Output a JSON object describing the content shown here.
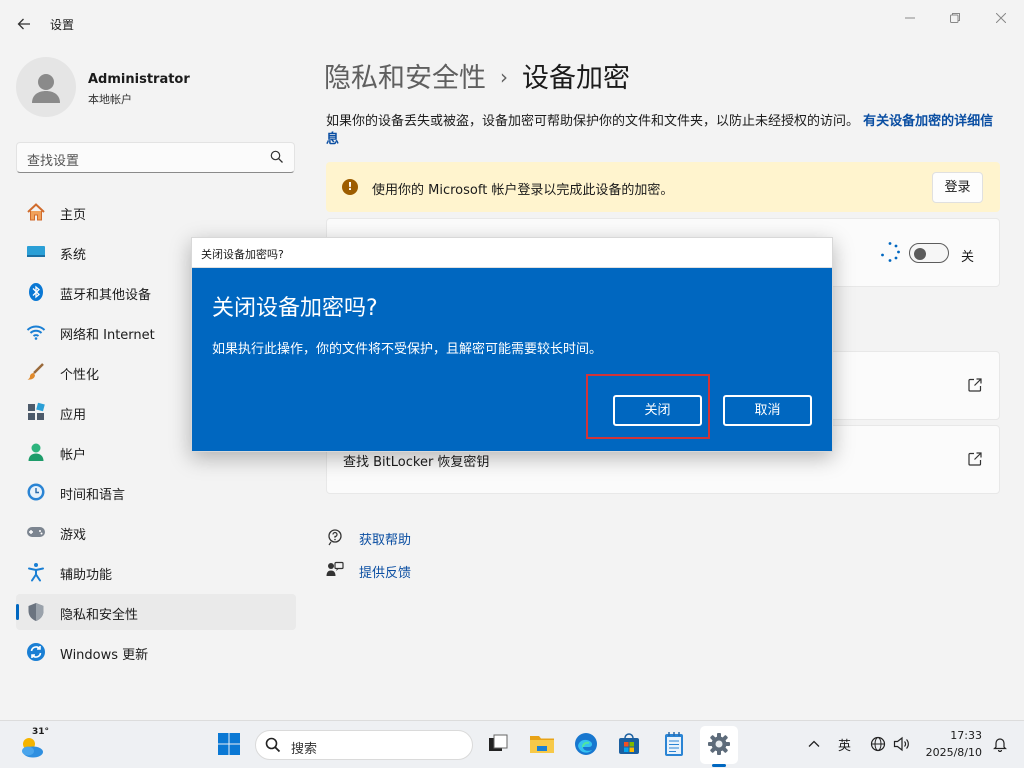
{
  "window": {
    "title": "设置"
  },
  "profile": {
    "name": "Administrator",
    "account_type": "本地帐户"
  },
  "search": {
    "placeholder": "查找设置"
  },
  "sidebar": {
    "items": [
      {
        "label": "主页",
        "icon": "home-icon"
      },
      {
        "label": "系统",
        "icon": "system-icon"
      },
      {
        "label": "蓝牙和其他设备",
        "icon": "bluetooth-icon"
      },
      {
        "label": "网络和 Internet",
        "icon": "wifi-icon"
      },
      {
        "label": "个性化",
        "icon": "brush-icon"
      },
      {
        "label": "应用",
        "icon": "apps-icon"
      },
      {
        "label": "帐户",
        "icon": "account-icon"
      },
      {
        "label": "时间和语言",
        "icon": "time-language-icon"
      },
      {
        "label": "游戏",
        "icon": "gamepad-icon"
      },
      {
        "label": "辅助功能",
        "icon": "accessibility-icon"
      },
      {
        "label": "隐私和安全性",
        "icon": "shield-icon"
      },
      {
        "label": "Windows 更新",
        "icon": "update-icon"
      }
    ],
    "active_index": 10
  },
  "breadcrumb": {
    "parent": "隐私和安全性",
    "separator": "›",
    "current": "设备加密"
  },
  "main": {
    "description": "如果你的设备丢失或被盗，设备加密可帮助保护你的文件和文件夹，以防止未经授权的访问。",
    "description_link": "有关设备加密的详细信息",
    "warning": {
      "text": "使用你的 Microsoft 帐户登录以完成此设备的加密。",
      "button": "登录"
    },
    "encryption_toggle": {
      "state_label": "关",
      "on": false
    },
    "link_card_2": "查找 BitLocker 恢复密钥",
    "help_links": [
      {
        "label": "获取帮助",
        "icon": "help-icon"
      },
      {
        "label": "提供反馈",
        "icon": "feedback-icon"
      }
    ]
  },
  "dialog": {
    "window_title": "关闭设备加密吗?",
    "heading": "关闭设备加密吗?",
    "message": "如果执行此操作，你的文件将不受保护，且解密可能需要较长时间。",
    "confirm_button": "关闭",
    "cancel_button": "取消",
    "highlight_color": "#d13438"
  },
  "taskbar": {
    "weather_temp": "31°",
    "search_placeholder": "搜索",
    "ime": "英",
    "time": "17:33",
    "date": "2025/8/10"
  },
  "colors": {
    "accent": "#0067c0",
    "warning_bg": "#fff4ce",
    "link": "#0a4ea2"
  }
}
